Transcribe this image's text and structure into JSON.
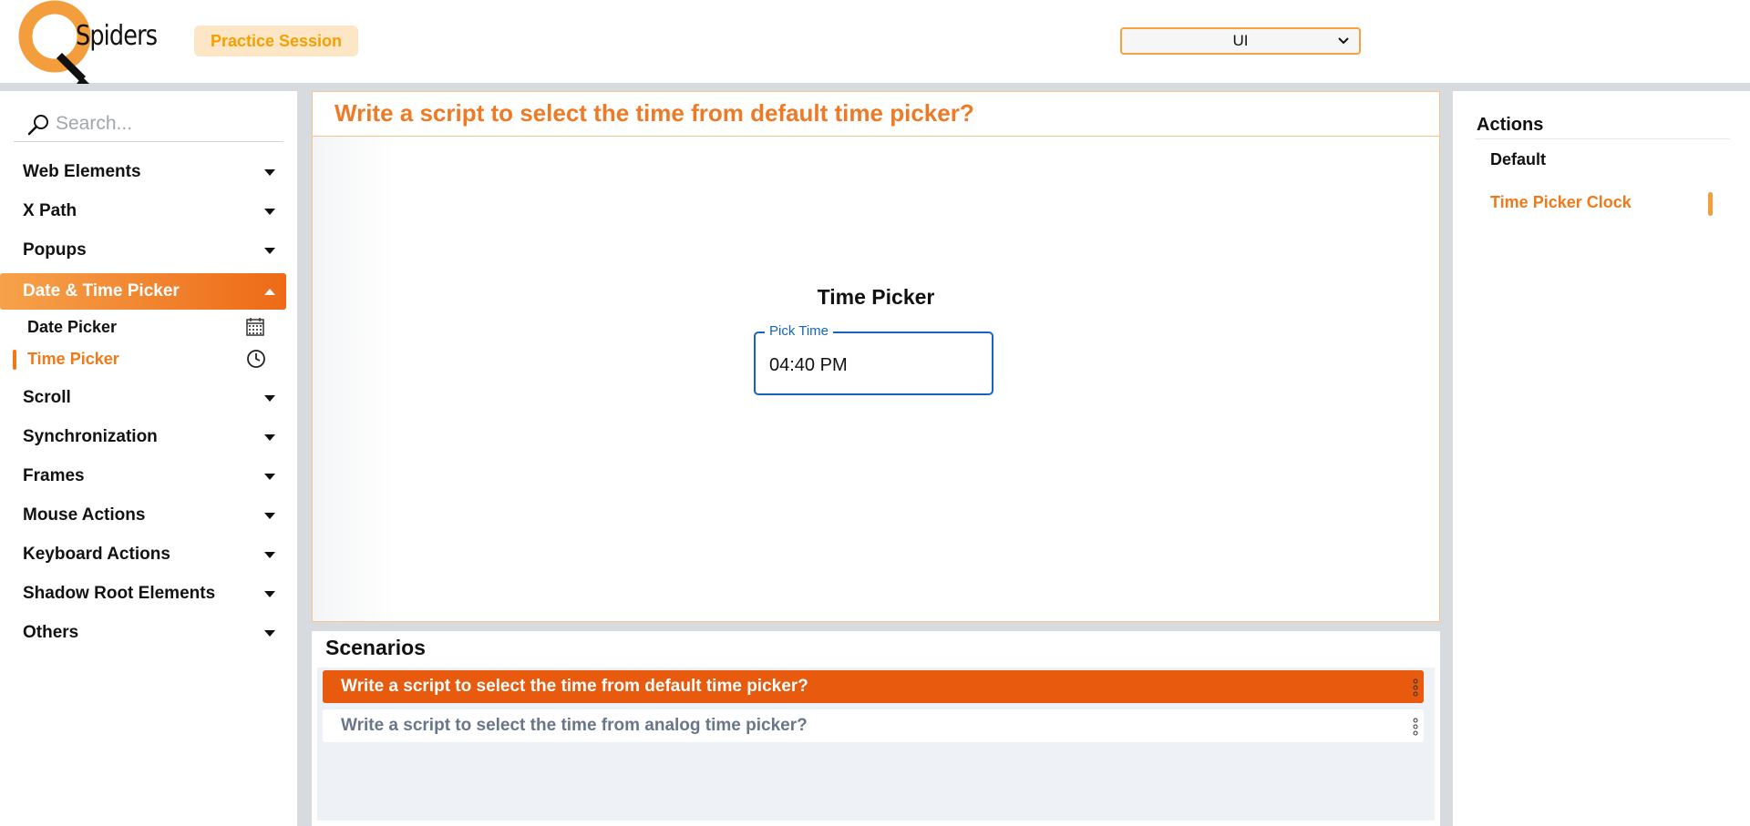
{
  "header": {
    "logo_text": "Spiders",
    "practice_badge": "Practice Session",
    "select_value": "UI"
  },
  "sidebar": {
    "search_placeholder": "Search...",
    "items": [
      {
        "label": "Web Elements"
      },
      {
        "label": "X Path"
      },
      {
        "label": "Popups"
      },
      {
        "label": "Date & Time Picker",
        "expanded": true
      },
      {
        "label": "Scroll"
      },
      {
        "label": "Synchronization"
      },
      {
        "label": "Frames"
      },
      {
        "label": "Mouse Actions"
      },
      {
        "label": "Keyboard Actions"
      },
      {
        "label": "Shadow Root Elements"
      },
      {
        "label": "Others"
      }
    ],
    "sub_items": [
      {
        "label": "Date Picker",
        "icon": "calendar-icon"
      },
      {
        "label": "Time Picker",
        "icon": "clock-icon",
        "selected": true
      }
    ]
  },
  "main": {
    "title": "Write a script to select the time from default time picker?",
    "time_picker_heading": "Time Picker",
    "field_label": "Pick Time",
    "field_value": "04:40 PM"
  },
  "scenarios": {
    "title": "Scenarios",
    "items": [
      {
        "label": "Write a script to select the time from default time picker?",
        "active": true
      },
      {
        "label": "Write a script to select the time from analog time picker?",
        "active": false
      }
    ]
  },
  "actions": {
    "title": "Actions",
    "items": [
      {
        "label": "Default"
      },
      {
        "label": "Time Picker Clock",
        "selected": true
      }
    ]
  },
  "colors": {
    "accent_orange": "#ef7a1a",
    "active_scenario": "#e85a0e",
    "field_blue": "#1565c0"
  }
}
